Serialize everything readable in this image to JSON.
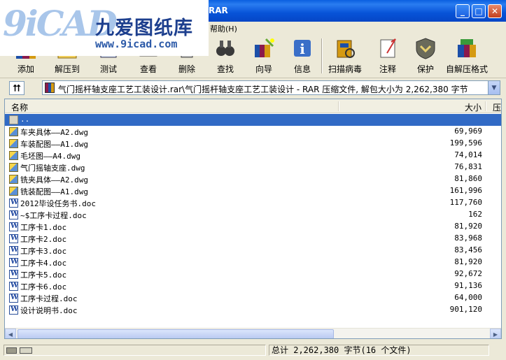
{
  "window": {
    "title_fragment": "RAR",
    "minimize": "_",
    "maximize": "□",
    "close": "✕"
  },
  "logo": {
    "mark": "9iCAD",
    "name": "九爱图纸库",
    "url": "www.9icad.com"
  },
  "menu": {
    "help": "帮助(H)"
  },
  "toolbar": {
    "add": "添加",
    "extract": "解压到",
    "test": "测试",
    "view": "查看",
    "delete": "删除",
    "find": "查找",
    "wizard": "向导",
    "info": "信息",
    "virus_scan": "扫描病毒",
    "comment": "注释",
    "protect": "保护",
    "sfx": "自解压格式"
  },
  "address": {
    "up_symbol": "⮅",
    "path": "气门摇杆轴支座工艺工装设计.rar\\气门摇杆轴支座工艺工装设计 - RAR 压缩文件, 解包大小为 2,262,380 字节"
  },
  "columns": {
    "name": "名称",
    "size": "大小",
    "packed": "压"
  },
  "files": [
    {
      "name": "..",
      "size": "",
      "icon": "folder",
      "selected": true
    },
    {
      "name": "车夹具体——A2.dwg",
      "size": "69,969",
      "icon": "dwg"
    },
    {
      "name": "车装配图——A1.dwg",
      "size": "199,596",
      "icon": "dwg"
    },
    {
      "name": "毛坯图——A4.dwg",
      "size": "74,014",
      "icon": "dwg"
    },
    {
      "name": "气门摇轴支座.dwg",
      "size": "76,831",
      "icon": "dwg"
    },
    {
      "name": "铣夹具体——A2.dwg",
      "size": "81,860",
      "icon": "dwg"
    },
    {
      "name": "铣装配图——A1.dwg",
      "size": "161,996",
      "icon": "dwg"
    },
    {
      "name": "2012毕设任务书.doc",
      "size": "117,760",
      "icon": "doc"
    },
    {
      "name": "~$工序卡过程.doc",
      "size": "162",
      "icon": "doc"
    },
    {
      "name": "工序卡1.doc",
      "size": "81,920",
      "icon": "doc"
    },
    {
      "name": "工序卡2.doc",
      "size": "83,968",
      "icon": "doc"
    },
    {
      "name": "工序卡3.doc",
      "size": "83,456",
      "icon": "doc"
    },
    {
      "name": "工序卡4.doc",
      "size": "81,920",
      "icon": "doc"
    },
    {
      "name": "工序卡5.doc",
      "size": "92,672",
      "icon": "doc"
    },
    {
      "name": "工序卡6.doc",
      "size": "91,136",
      "icon": "doc"
    },
    {
      "name": "工序卡过程.doc",
      "size": "64,000",
      "icon": "doc"
    },
    {
      "name": "设计说明书.doc",
      "size": "901,120",
      "icon": "doc"
    }
  ],
  "status": {
    "summary": "总计 2,262,380 字节(16 个文件)"
  },
  "colors": {
    "titlebar": "#0a5fe0",
    "selection": "#316ac5",
    "chrome": "#ece9d8"
  }
}
